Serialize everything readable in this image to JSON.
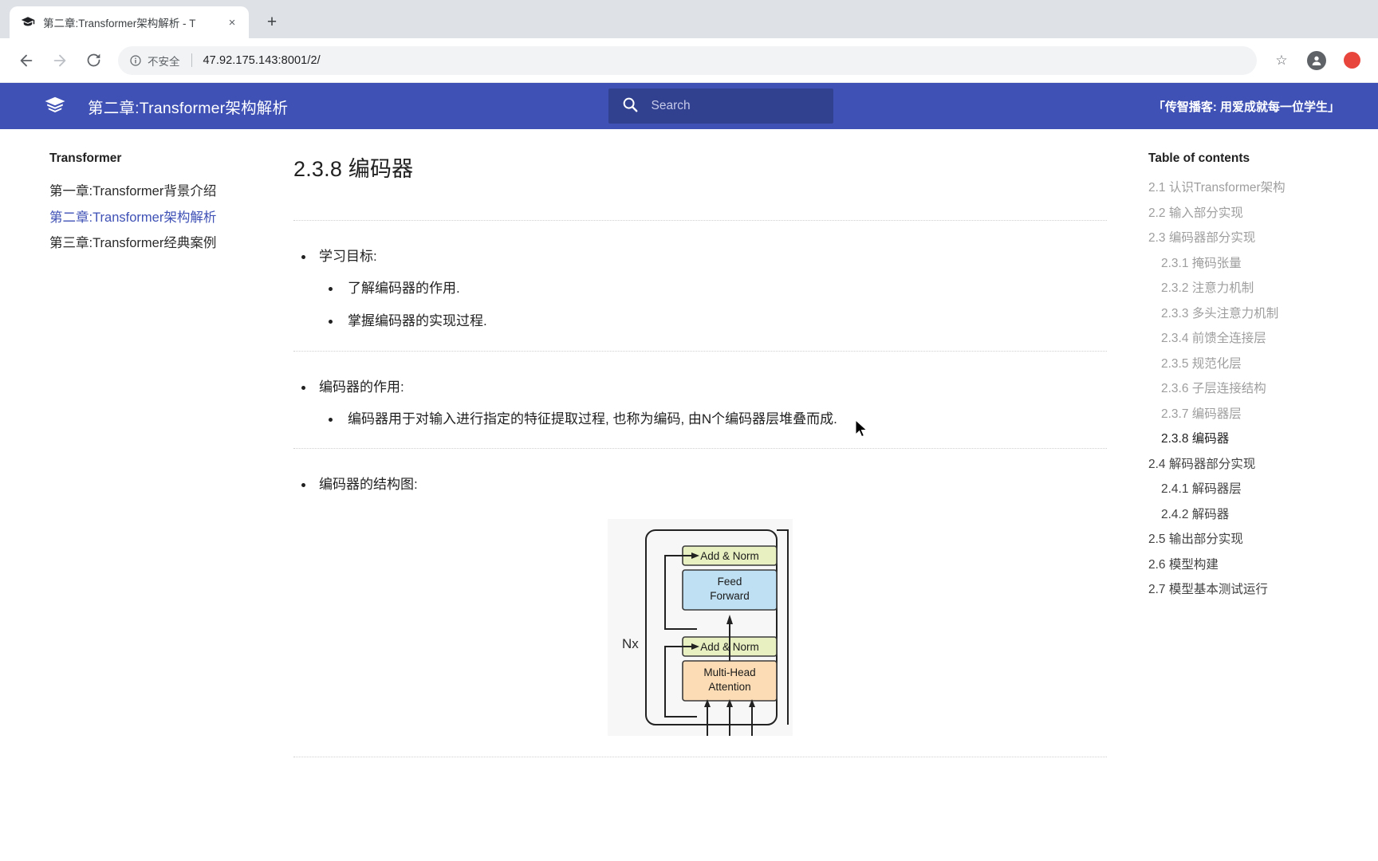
{
  "browser": {
    "tab": {
      "title": "第二章:Transformer架构解析 - T",
      "favicon": "graduation-cap-icon",
      "close": "×"
    },
    "newtab_label": "+",
    "nav": {
      "back": "←",
      "forward": "→",
      "reload": "⟳"
    },
    "omnibox": {
      "security_label": "不安全",
      "url": "47.92.175.143:8001/2/",
      "star": "☆"
    }
  },
  "header": {
    "title": "第二章:Transformer架构解析",
    "logo": "book-logo-icon",
    "search": {
      "placeholder": "Search",
      "value": "",
      "icon": "search-icon"
    },
    "slogan": "「传智播客: 用爱成就每一位学生」"
  },
  "sidebar": {
    "title": "Transformer",
    "items": [
      {
        "label": "第一章:Transformer背景介绍",
        "active": false
      },
      {
        "label": "第二章:Transformer架构解析",
        "active": true
      },
      {
        "label": "第三章:Transformer经典案例",
        "active": false
      }
    ]
  },
  "main": {
    "heading": "2.3.8 编码器",
    "sections": [
      {
        "bullet": "学习目标:",
        "children": [
          "了解编码器的作用.",
          "掌握编码器的实现过程."
        ]
      },
      {
        "bullet": "编码器的作用:",
        "children": [
          "编码器用于对输入进行指定的特征提取过程, 也称为编码, 由N个编码器层堆叠而成."
        ]
      },
      {
        "bullet": "编码器的结构图:",
        "children": []
      }
    ],
    "figure": {
      "name": "transformer-encoder-diagram",
      "nx_label": "Nx",
      "blocks": [
        {
          "label": "Add & Norm",
          "color": "#e8efc0"
        },
        {
          "label": "Feed\nForward",
          "color": "#bfe0f2"
        },
        {
          "label": "Add & Norm",
          "color": "#e8efc0"
        },
        {
          "label": "Multi-Head\nAttention",
          "color": "#fbdcb4"
        }
      ]
    }
  },
  "toc": {
    "title": "Table of contents",
    "items": [
      {
        "label": "2.1 认识Transformer架构",
        "level": 2,
        "state": "normal"
      },
      {
        "label": "2.2 输入部分实现",
        "level": 2,
        "state": "normal"
      },
      {
        "label": "2.3 编码器部分实现",
        "level": 2,
        "state": "normal"
      },
      {
        "label": "2.3.1 掩码张量",
        "level": 3,
        "state": "normal"
      },
      {
        "label": "2.3.2 注意力机制",
        "level": 3,
        "state": "normal"
      },
      {
        "label": "2.3.3 多头注意力机制",
        "level": 3,
        "state": "normal"
      },
      {
        "label": "2.3.4 前馈全连接层",
        "level": 3,
        "state": "normal"
      },
      {
        "label": "2.3.5 规范化层",
        "level": 3,
        "state": "normal"
      },
      {
        "label": "2.3.6 子层连接结构",
        "level": 3,
        "state": "normal"
      },
      {
        "label": "2.3.7 编码器层",
        "level": 3,
        "state": "normal"
      },
      {
        "label": "2.3.8 编码器",
        "level": 3,
        "state": "active"
      },
      {
        "label": "2.4 解码器部分实现",
        "level": 2,
        "state": "dark"
      },
      {
        "label": "2.4.1 解码器层",
        "level": 3,
        "state": "dark"
      },
      {
        "label": "2.4.2 解码器",
        "level": 3,
        "state": "dark"
      },
      {
        "label": "2.5 输出部分实现",
        "level": 2,
        "state": "dark"
      },
      {
        "label": "2.6 模型构建",
        "level": 2,
        "state": "dark"
      },
      {
        "label": "2.7 模型基本测试运行",
        "level": 2,
        "state": "dark"
      }
    ]
  },
  "colors": {
    "header_bg": "#3f51b5",
    "accent": "#3f51b5",
    "tabstrip_bg": "#dee1e6"
  }
}
